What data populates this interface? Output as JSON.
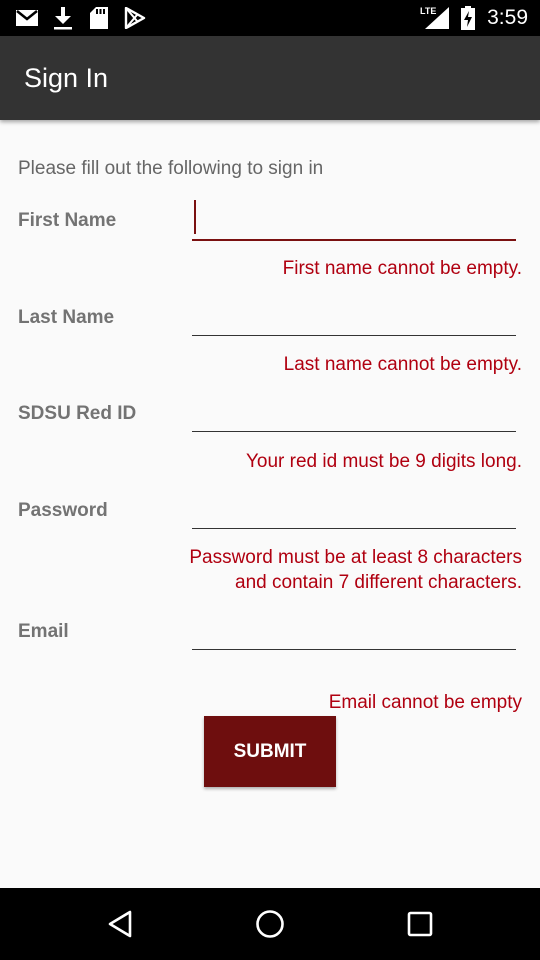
{
  "status_bar": {
    "time": "3:59",
    "network": "LTE",
    "icons": [
      "gmail-icon",
      "download-icon",
      "sd-card-icon",
      "play-store-icon",
      "signal-icon",
      "battery-charging-icon"
    ]
  },
  "app_bar": {
    "title": "Sign In"
  },
  "form": {
    "intro": "Please fill out the following to sign in",
    "fields": [
      {
        "label": "First Name",
        "value": "",
        "error": "First name cannot be empty."
      },
      {
        "label": "Last Name",
        "value": "",
        "error": "Last name cannot be empty."
      },
      {
        "label": "SDSU Red ID",
        "value": "",
        "error": "Your red id must be 9 digits long."
      },
      {
        "label": "Password",
        "value": "",
        "error_line1": "Password must be at least 8 characters",
        "error_line2": "and contain 7 different characters."
      },
      {
        "label": "Email",
        "value": "",
        "error": "Email cannot be empty"
      }
    ],
    "submit_label": "SUBMIT"
  },
  "colors": {
    "app_bar": "#333333",
    "accent": "#6e0e0e",
    "error": "#b00010"
  }
}
